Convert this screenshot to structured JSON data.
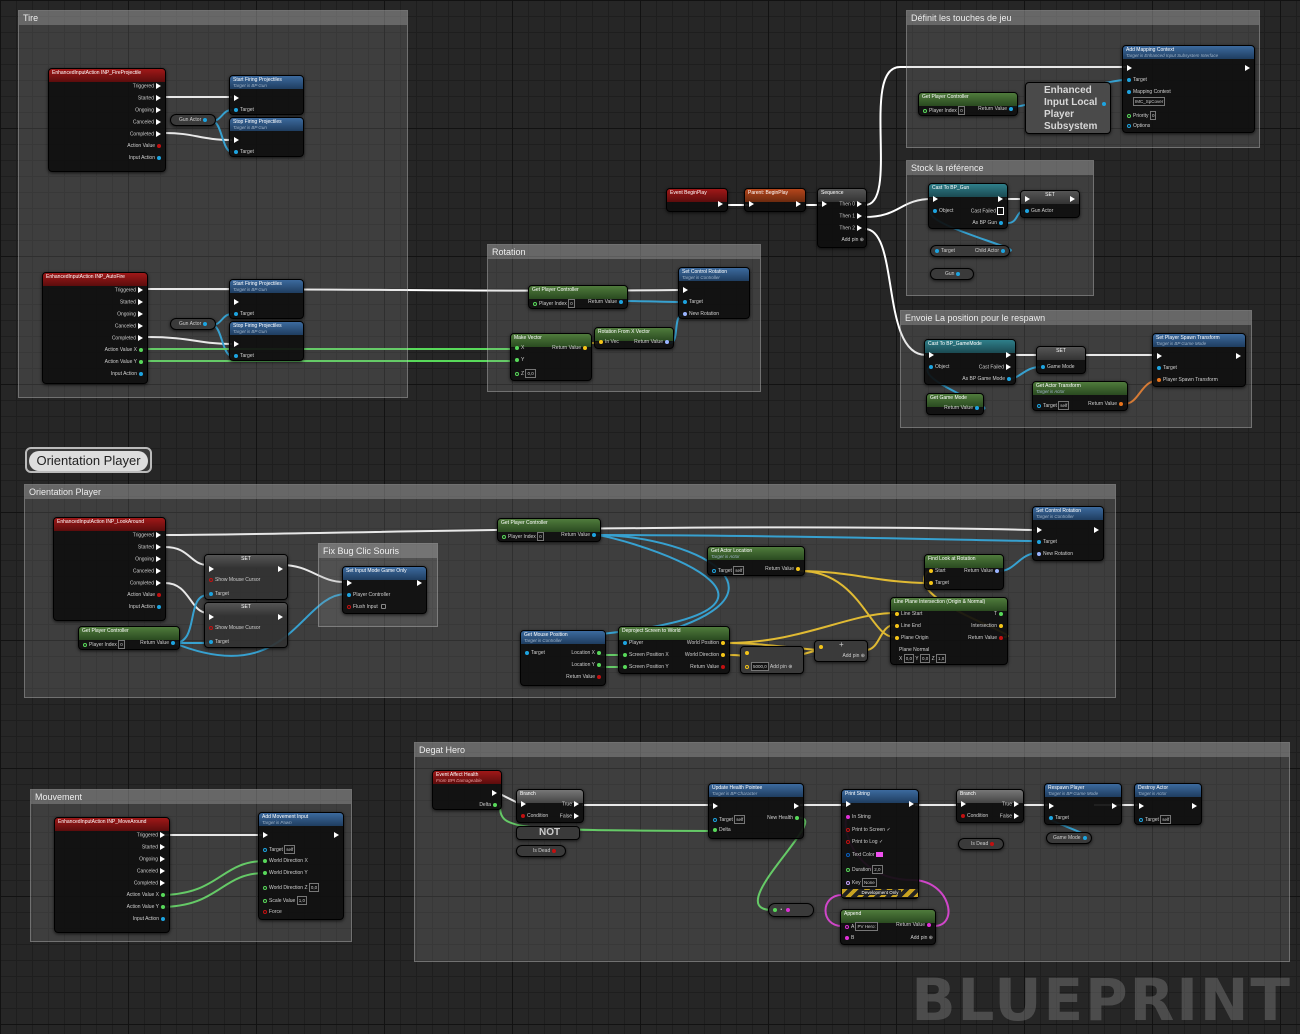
{
  "comments": {
    "tire": "Tire",
    "touches": "Définit les touches de jeu",
    "reference": "Stock la référence",
    "rotation": "Rotation",
    "respawn": "Envoie La position pour le respawn",
    "orientation": "Orientation Player",
    "bugfix": "Fix Bug Clic Souris",
    "mouvement": "Mouvement",
    "degat": "Degat Hero"
  },
  "bubble": "Orientation Player",
  "watermark": "BLUEPRINT",
  "colors": {
    "exec": "#ffffff",
    "object": "#1da4e0",
    "float": "#58d95a",
    "vector": "#f5c518",
    "bool": "#c21010",
    "string": "#e030d8",
    "struct": "#0a5fbf"
  },
  "labels": {
    "n_fire": "EnhancedInputAction INP_FireProjectile",
    "triggered": "Triggered",
    "started": "Started",
    "ongoing": "Ongoing",
    "canceled": "Canceled",
    "completed": "Completed",
    "action_value": "Action Value",
    "input_action": "Input Action",
    "start_fire": "Start Firing Projectiles",
    "stop_fire": "Stop Firing Projectiles",
    "target_gun": "Target is BP Gun",
    "target": "Target",
    "gun_actor": "Gun Actor",
    "n_autofire": "EnhancedInputAction INP_AutoFire",
    "action_value_x": "Action Value X",
    "action_value_y": "Action Value Y",
    "get_pc": "Get Player Controller",
    "player_index": "Player Index",
    "return_value": "Return Value",
    "zero": "0",
    "set_ctrl_rot": "Set Control Rotation",
    "target_ctrl": "Target is Controller",
    "new_rotation": "New Rotation",
    "make_vector": "Make Vector",
    "x": "X",
    "y": "Y",
    "z": "Z",
    "z_val": "0,0",
    "rot_from_x": "Rotation From X Vector",
    "in_vec": "In Vec",
    "ev_beginplay": "Event BeginPlay",
    "parent_beginplay": "Parent: BeginPlay",
    "sequence": "Sequence",
    "then0": "Then 0",
    "then1": "Then 1",
    "then2": "Then 2",
    "add_pin": "Add pin",
    "add_mapping": "Add Mapping Context",
    "target_subsys": "Target is Enhanced Input Subsystem Interface",
    "mapping_context": "Mapping Context",
    "imc_value": "IMC_SpCover",
    "priority": "Priority",
    "priority_val": "0",
    "options": "Options",
    "enhanced_subsys": "Enhanced Input Local Player Subsystem",
    "cast_gun": "Cast To BP_Gun",
    "object": "Object",
    "cast_failed": "Cast Failed",
    "as_gun": "As BP Gun",
    "set": "SET",
    "child_actor": "Child Actor",
    "gun": "Gun",
    "cast_gm": "Cast To BP_GameMode",
    "as_gm": "As BP Game Mode",
    "game_mode": "Game Mode",
    "get_gm": "Get Game Mode",
    "set_spawn": "Set Player Spawn Transform",
    "target_gamemode": "Target is BP Game Mode",
    "player_spawn_transform": "Player Spawn Transform",
    "get_actor_transform": "Get Actor Transform",
    "target_actor": "Target is Actor",
    "self": "self",
    "n_lookaround": "EnhancedInputAction INP_LookAround",
    "show_mouse": "Show Mouse Cursor",
    "set_input_mode": "Set Input Mode Game Only",
    "player_controller": "Player Controller",
    "flush_input": "Flush Input",
    "get_actor_loc": "Get Actor Location",
    "find_look": "Find Look at Rotation",
    "start": "Start",
    "get_mouse_pos": "Get Mouse Position",
    "location_x": "Location X",
    "location_y": "Location Y",
    "deproject": "Deproject Screen to World",
    "player": "Player",
    "screen_pos_x": "Screen Position X",
    "screen_pos_y": "Screen Position Y",
    "world_position": "World Position",
    "world_direction": "World Direction",
    "mult_val": "5000,0",
    "line_plane": "Line Plane Intersection (Origin & Normal)",
    "line_start": "Line Start",
    "line_end": "Line End",
    "plane_origin": "Plane Origin",
    "plane_normal": "Plane Normal",
    "t": "T",
    "intersection": "Intersection",
    "pn_x": "0,0",
    "pn_y": "0,0",
    "pn_z": "1,0",
    "n_move": "EnhancedInputAction INP_MoveAround",
    "add_move": "Add Movement Input",
    "target_pawn": "Target is Pawn",
    "world_dir_x": "World Direction X",
    "world_dir_y": "World Direction Y",
    "world_dir_z": "World Direction Z",
    "scale_value": "Scale Value",
    "scale_val": "1,0",
    "force": "Force",
    "ev_affect": "Event Affect Health",
    "from_dmg": "From BPI Damageable",
    "delta": "Delta",
    "branch": "Branch",
    "true": "True",
    "false": "False",
    "condition": "Condition",
    "not": "NOT",
    "is_dead": "Is Dead",
    "update_health": "Update Health Pointee",
    "target_char": "Target is BP Character",
    "new_health": "New Health",
    "print_string": "Print String",
    "in_string": "In String",
    "print_screen": "Print to Screen",
    "print_log": "Print to Log",
    "text_color": "Text Color",
    "duration": "Duration",
    "duration_val": "2,0",
    "key": "Key",
    "key_val": "None",
    "dev_only": "Development Only",
    "append": "Append",
    "a": "A",
    "b": "B",
    "a_val": "PV Hero:",
    "respawn": "Respawn Player",
    "destroy": "Destroy Actor"
  }
}
